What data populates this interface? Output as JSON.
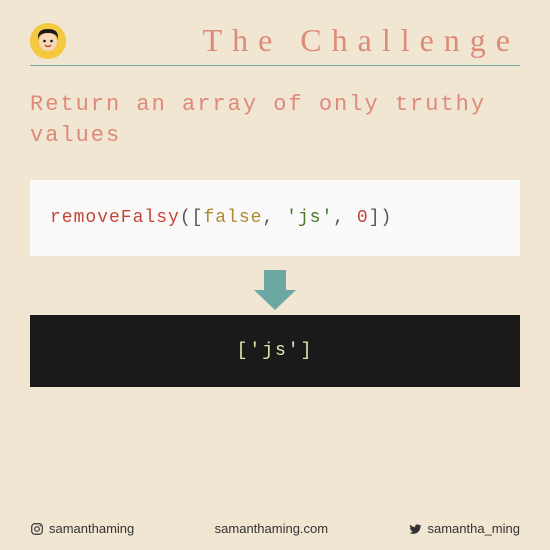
{
  "header": {
    "title": "The Challenge"
  },
  "subtitle": "Return an array of only truthy values",
  "code": {
    "fn": "removeFalsy",
    "open_paren": "(",
    "open_bracket": "[",
    "arg1": "false",
    "comma1": ", ",
    "arg2": "'js'",
    "comma2": ", ",
    "arg3": "0",
    "close_bracket": "]",
    "close_paren": ")"
  },
  "output": "['js']",
  "footer": {
    "instagram": "samanthaming",
    "website": "samanthaming.com",
    "twitter": "samantha_ming"
  }
}
